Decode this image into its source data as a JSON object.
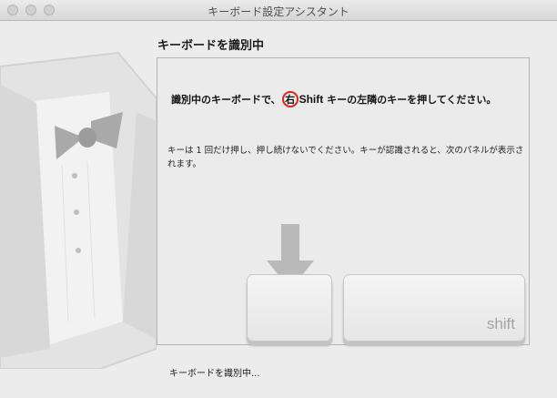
{
  "window": {
    "title": "キーボード設定アシスタント"
  },
  "page": {
    "heading": "キーボードを識別中"
  },
  "instruction": {
    "prefix": "識別中のキーボードで、",
    "circled_char": "右",
    "key_name": "Shift",
    "suffix": " キーの左隣のキーを押してください。"
  },
  "note": "キーは 1 回だけ押し、押し続けないでください。キーが認識されると、次のパネルが表示されます。",
  "keys": {
    "shift_label": "shift"
  },
  "status": "キーボードを識別中...",
  "colors": {
    "highlight_circle": "#d9261c",
    "arrow": "#b9b9b9"
  }
}
